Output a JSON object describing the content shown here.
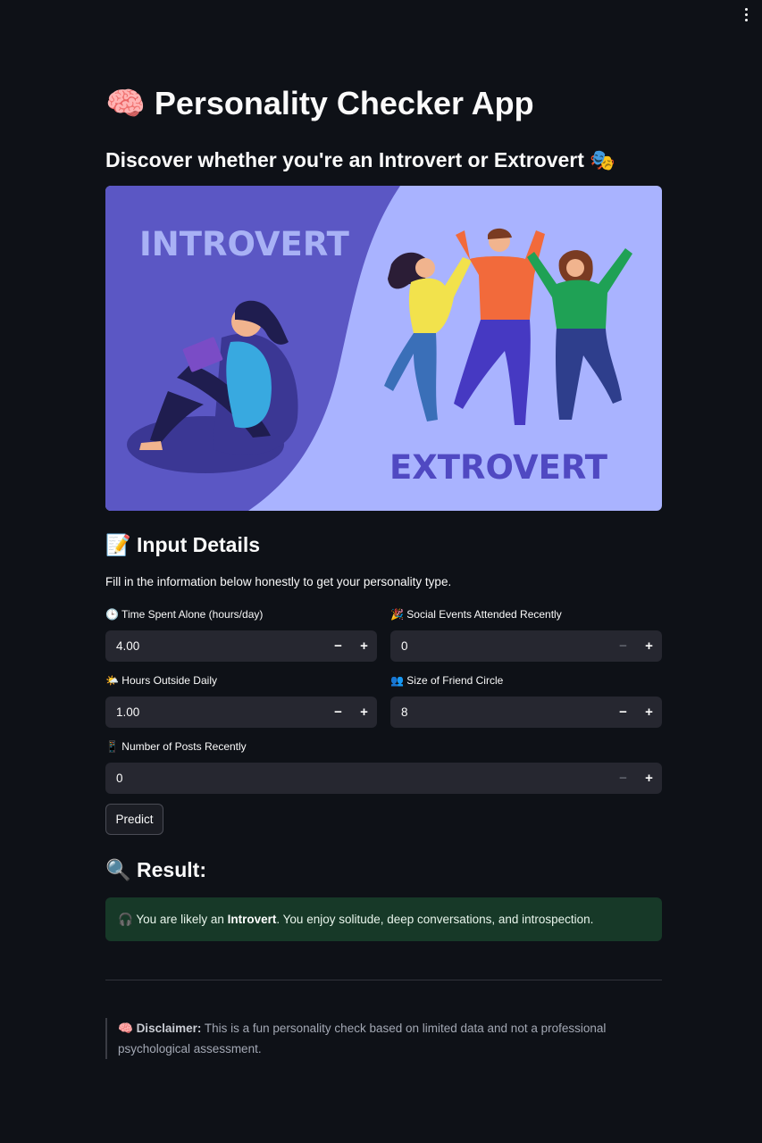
{
  "app": {
    "title": "🧠 Personality Checker App",
    "subtitle": "Discover whether you're an Introvert or Extrovert 🎭"
  },
  "hero": {
    "left_text": "INTROVERT",
    "right_text": "EXTROVERT",
    "colors": {
      "left_bg": "#5b57c4",
      "right_bg": "#a9b3ff",
      "text_left": "#a8b1f5",
      "text_right": "#5049c2"
    }
  },
  "input_section": {
    "title": "📝 Input Details",
    "intro": "Fill in the information below honestly to get your personality type.",
    "fields": [
      {
        "label": "🕒 Time Spent Alone (hours/day)",
        "value": "4.00"
      },
      {
        "label": "🎉 Social Events Attended Recently",
        "value": "0"
      },
      {
        "label": "🌤️ Hours Outside Daily",
        "value": "1.00"
      },
      {
        "label": "👥 Size of Friend Circle",
        "value": "8"
      },
      {
        "label": "📱 Number of Posts Recently",
        "value": "0"
      }
    ],
    "minus_symbol": "−",
    "plus_symbol": "+"
  },
  "predict_button": "Predict",
  "result": {
    "title": "🔍 Result:",
    "prefix": "🎧 You are likely an ",
    "type": "Introvert",
    "suffix": ". You enjoy solitude, deep conversations, and introspection.",
    "bg_color": "#173928"
  },
  "disclaimer": {
    "prefix": "🧠 ",
    "label": "Disclaimer:",
    "text": " This is a fun personality check based on limited data and not a professional psychological assessment."
  }
}
